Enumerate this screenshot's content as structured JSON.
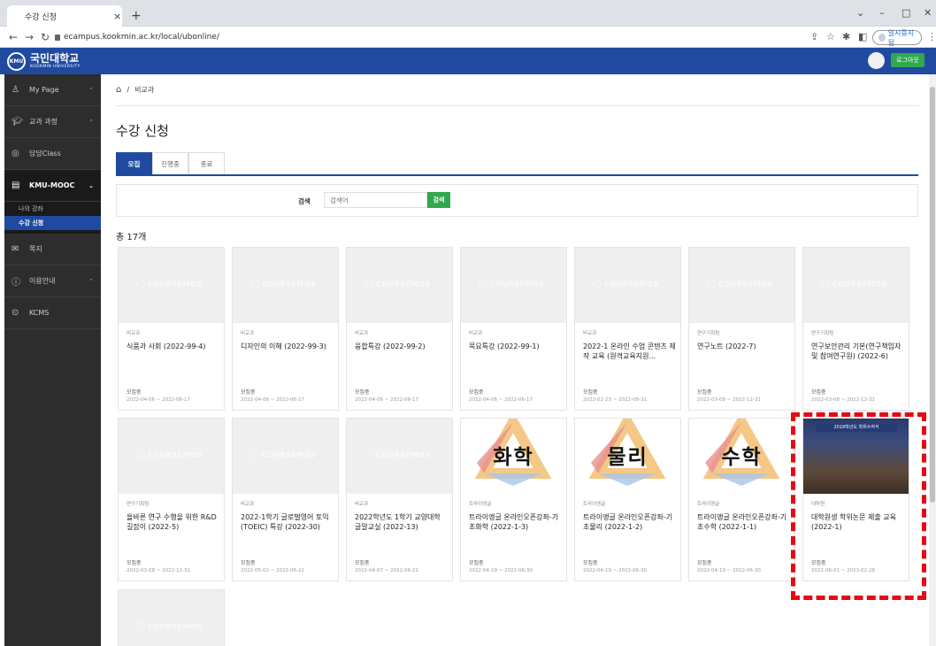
{
  "browser": {
    "tab_title": "수강 신청",
    "url": "ecampus.kookmin.ac.kr/local/ubonline/",
    "paused_label": "일시중지됨"
  },
  "header": {
    "logo_seal": "KMU",
    "logo_ko": "국민대학교",
    "logo_en": "KOOKMIN UNIVERSITY",
    "logout_label": "로그아웃",
    "brand_color": "#1f4aa0",
    "accent_color": "#2fa84f"
  },
  "sidebar": {
    "items": [
      {
        "label": "My Page",
        "icon": "user-icon"
      },
      {
        "label": "교과 과정",
        "icon": "graduation-cap-icon"
      },
      {
        "label": "담당Class",
        "icon": "class-icon"
      },
      {
        "label": "KMU-MOOC",
        "icon": "book-icon"
      },
      {
        "label": "쪽지",
        "icon": "mail-icon"
      },
      {
        "label": "이용안내",
        "icon": "info-icon"
      },
      {
        "label": "KCMS",
        "icon": "play-circle-icon"
      }
    ],
    "sub_items": [
      {
        "label": "나의 강좌"
      },
      {
        "label": "수강 신청"
      }
    ]
  },
  "breadcrumb": {
    "current": "비교과"
  },
  "page": {
    "title": "수강 신청",
    "tabs": [
      "모집",
      "진행중",
      "종료"
    ],
    "search_label": "검색",
    "search_placeholder": "검색어",
    "search_button": "검색",
    "total": "총 17개"
  },
  "thumb_watermark": "COURSEMOS",
  "courses": [
    {
      "category": "비교과",
      "title": "식품과 사회 (2022-99-4)",
      "status": "모집중",
      "dates": "2022-04-06 ~ 2022-06-17",
      "thumb": "placeholder"
    },
    {
      "category": "비교과",
      "title": "디자인의 이해 (2022-99-3)",
      "status": "모집중",
      "dates": "2022-04-06 ~ 2022-06-17",
      "thumb": "placeholder"
    },
    {
      "category": "비교과",
      "title": "융합특강 (2022-99-2)",
      "status": "모집중",
      "dates": "2022-04-06 ~ 2022-06-17",
      "thumb": "placeholder"
    },
    {
      "category": "비교과",
      "title": "목요특강 (2022-99-1)",
      "status": "모집중",
      "dates": "2022-04-06 ~ 2022-06-17",
      "thumb": "placeholder"
    },
    {
      "category": "비교과",
      "title": "2022-1 온라인 수업 콘텐츠 제작 교육 (원격교육지원...",
      "status": "모집중",
      "dates": "2022-02-23 ~ 2022-08-31",
      "thumb": "placeholder"
    },
    {
      "category": "연구기획팀",
      "title": "연구노트 (2022-7)",
      "status": "모집중",
      "dates": "2022-03-08 ~ 2022-12-31",
      "thumb": "placeholder"
    },
    {
      "category": "연구기획팀",
      "title": "연구보안관리 기본(연구책임자 및 참여연구원) (2022-6)",
      "status": "모집중",
      "dates": "2022-03-08 ~ 2022-12-31",
      "thumb": "placeholder"
    },
    {
      "category": "연구기획팀",
      "title": "올바른 연구 수행을 위한 R&D 길잡이 (2022-5)",
      "status": "모집중",
      "dates": "2022-03-08 ~ 2022-12-31",
      "thumb": "placeholder"
    },
    {
      "category": "비교과",
      "title": "2022-1학기 글로벌영어 토익(TOEIC) 특강 (2022-30)",
      "status": "모집중",
      "dates": "2022-05-02 ~ 2022-06-21",
      "thumb": "placeholder"
    },
    {
      "category": "비교과",
      "title": "2022학년도 1학기 교양대학 글말교실 (2022-13)",
      "status": "모집중",
      "dates": "2022-04-07 ~ 2022-06-21",
      "thumb": "placeholder"
    },
    {
      "category": "트라이앵글",
      "title": "트라이앵글 온라인오픈강좌-기초화학 (2022-1-3)",
      "status": "모집중",
      "dates": "2022-04-19 ~ 2022-06-30",
      "thumb": "triangle",
      "thumb_word": "화학"
    },
    {
      "category": "트라이앵글",
      "title": "트라이앵글 온라인오픈강좌-기초물리 (2022-1-2)",
      "status": "모집중",
      "dates": "2022-04-19 ~ 2022-06-30",
      "thumb": "triangle",
      "thumb_word": "물리"
    },
    {
      "category": "트라이앵글",
      "title": "트라이앵글 온라인오픈강좌-기초수학 (2022-1-1)",
      "status": "모집중",
      "dates": "2022-04-19 ~ 2022-06-30",
      "thumb": "triangle",
      "thumb_word": "수학"
    },
    {
      "category": "대학원",
      "title": "대학원생 학위논문 제출 교육 (2022-1)",
      "status": "모집중",
      "dates": "2022-06-01 ~ 2023-02-28",
      "thumb": "photo",
      "thumb_banner": "2018학년도 학위수여식"
    },
    {
      "category": "",
      "title": "",
      "status": "",
      "dates": "",
      "thumb": "placeholder"
    }
  ]
}
